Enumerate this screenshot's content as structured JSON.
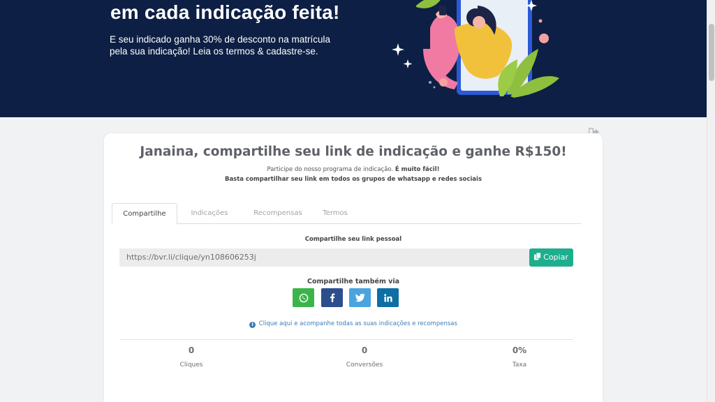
{
  "hero": {
    "headline": "em cada indicação feita!",
    "sub_line1": "E seu indicado ganha 30% de desconto na matrícula",
    "sub_line2": "pela sua indicação! Leia os termos & cadastre-se."
  },
  "card": {
    "title": "Janaina, compartilhe seu link de indicação e ganhe R$150!",
    "desc_line1": "Participe do nosso programa de indicação.",
    "desc_line1_bold": "É muito fácil!",
    "desc_line2": "Basta compartilhar seu link em todos os grupos de whatsapp e redes sociais"
  },
  "tabs": [
    {
      "label": "Compartilhe",
      "active": true
    },
    {
      "label": "Indicações",
      "active": false
    },
    {
      "label": "Recompensas",
      "active": false
    },
    {
      "label": "Termos",
      "active": false
    }
  ],
  "share": {
    "label": "Compartilhe seu link pessoal",
    "link": "https://bvr.li/clique/yn108606253j",
    "copy_label": "Copiar",
    "also_label": "Compartilhe também via",
    "networks": [
      {
        "name": "whatsapp",
        "color": "#3bb54a"
      },
      {
        "name": "facebook",
        "color": "#2d4e8c"
      },
      {
        "name": "twitter",
        "color": "#4aa4de"
      },
      {
        "name": "linkedin",
        "color": "#0f6ea3"
      }
    ],
    "info_link": "Clique aqui e acompanhe todas as suas indicações e recompensas"
  },
  "stats": [
    {
      "value": "0",
      "label": "Cliques"
    },
    {
      "value": "0",
      "label": "Conversões"
    },
    {
      "value": "0%",
      "label": "Taxa"
    }
  ],
  "colors": {
    "hero_bg": "#0d1f44",
    "accent_green": "#1dae8d",
    "link_blue": "#3a7cb8"
  },
  "icons": [
    "logout-icon",
    "copy-icon",
    "whatsapp-icon",
    "facebook-icon",
    "twitter-icon",
    "linkedin-icon",
    "info-icon"
  ]
}
